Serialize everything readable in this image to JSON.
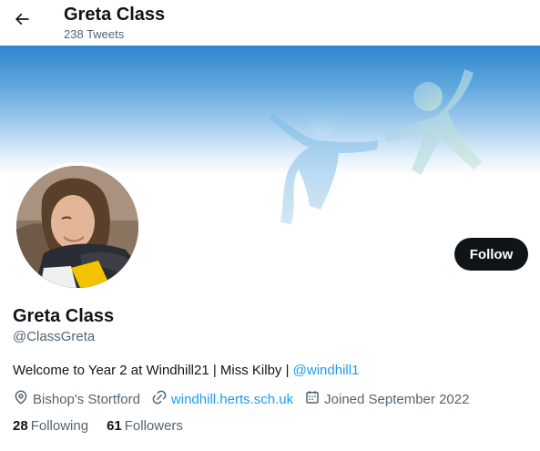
{
  "header": {
    "title": "Greta Class",
    "tweet_count": "238 Tweets"
  },
  "profile": {
    "name": "Greta Class",
    "handle": "@ClassGreta",
    "bio_text": "Welcome to Year 2 at Windhill21 | Miss Kilby | ",
    "bio_mention": "@windhill1",
    "location": "Bishop's Stortford",
    "website": "windhill.herts.sch.uk",
    "joined": "Joined September 2022",
    "following_count": "28",
    "following_label": "Following",
    "followers_count": "61",
    "followers_label": "Followers",
    "follow_button": "Follow"
  },
  "icons": {
    "back": "arrow-left-icon",
    "location": "location-pin-icon",
    "website": "link-icon",
    "joined": "calendar-icon"
  },
  "colors": {
    "accent": "#1d9bf0",
    "text_primary": "#0f1419",
    "text_secondary": "#536471",
    "follow_button_bg": "#0f1419"
  }
}
